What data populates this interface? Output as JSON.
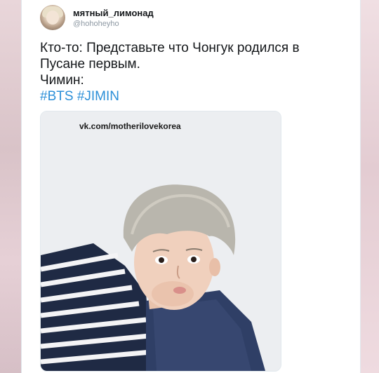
{
  "tweet": {
    "author": {
      "display_name": "мятный_лимонад",
      "handle": "@hohoheyho"
    },
    "lines": [
      "Кто-то: Представьте что Чонгук родился в",
      "Пусане первым.",
      "Чимин:"
    ],
    "hashtags": [
      "#BTS",
      "#JIMIN"
    ],
    "media": {
      "watermark": "vk.com/motherilovekorea"
    }
  },
  "colors": {
    "hashtag": "#2b8fd8",
    "text": "#14171a",
    "handle": "#8d98a3"
  }
}
